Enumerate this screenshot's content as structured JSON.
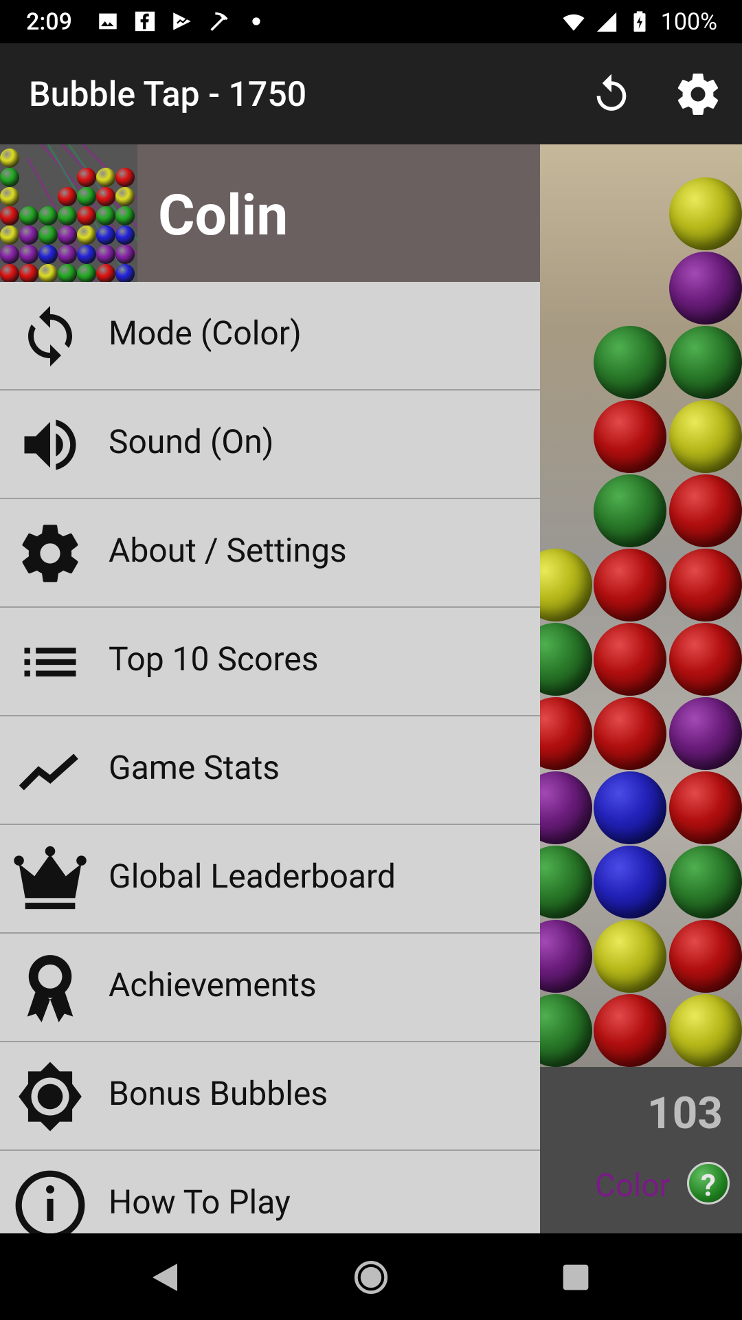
{
  "status_bar": {
    "time": "2:09",
    "battery": "100%",
    "icons": [
      "image-icon",
      "facebook-icon",
      "play-games-icon",
      "pickaxe-icon",
      "dot-icon",
      "wifi-icon",
      "signal-icon",
      "battery-icon"
    ]
  },
  "app_bar": {
    "title": "Bubble Tap - 1750",
    "actions": [
      "restart-icon",
      "settings-icon"
    ]
  },
  "drawer": {
    "user_name": "Colin",
    "items": [
      {
        "label": "Mode (Color)",
        "icon": "sync-icon"
      },
      {
        "label": "Sound (On)",
        "icon": "volume-icon"
      },
      {
        "label": "About / Settings",
        "icon": "gear-icon"
      },
      {
        "label": "Top 10 Scores",
        "icon": "list-icon"
      },
      {
        "label": "Game Stats",
        "icon": "trend-icon"
      },
      {
        "label": "Global Leaderboard",
        "icon": "crown-icon"
      },
      {
        "label": "Achievements",
        "icon": "award-icon"
      },
      {
        "label": "Bonus Bubbles",
        "icon": "bonus-icon"
      },
      {
        "label": "How To Play",
        "icon": "info-icon"
      }
    ]
  },
  "game": {
    "score": "103",
    "mode": "Color",
    "help": "?"
  },
  "colors": {
    "drawer_bg": "#d3d3d3",
    "header_bg": "#6b6060",
    "app_bar_bg": "#212121",
    "mode_text": "#7a1a86"
  }
}
